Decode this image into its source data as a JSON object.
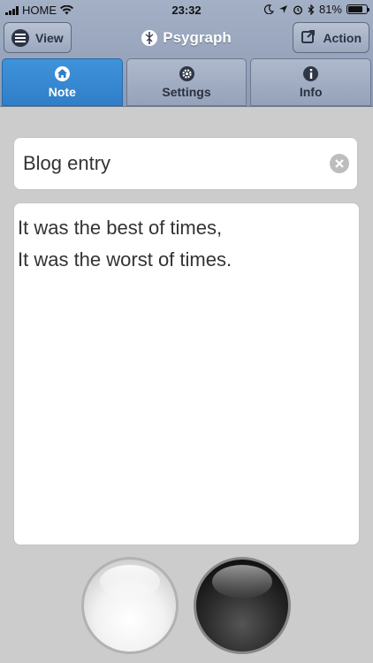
{
  "status_bar": {
    "carrier": "HOME",
    "time": "23:32",
    "battery": "81%",
    "battery_level": 0.81
  },
  "header": {
    "app_title": "Psygraph",
    "view_label": "View",
    "action_label": "Action",
    "icons": {
      "view": "menu-icon",
      "action": "share-icon",
      "logo": "psygraph-logo-icon"
    }
  },
  "tabs": [
    {
      "label": "Note",
      "icon": "home-icon",
      "active": true
    },
    {
      "label": "Settings",
      "icon": "gear-icon",
      "active": false
    },
    {
      "label": "Info",
      "icon": "info-icon",
      "active": false
    }
  ],
  "note": {
    "title_value": "Blog entry",
    "body_lines": [
      "It was the best of times,",
      "It was the worst of times."
    ]
  },
  "colors": {
    "header": "#95a2b8",
    "active_tab": "#2f7fc8",
    "background": "#cccccc"
  }
}
